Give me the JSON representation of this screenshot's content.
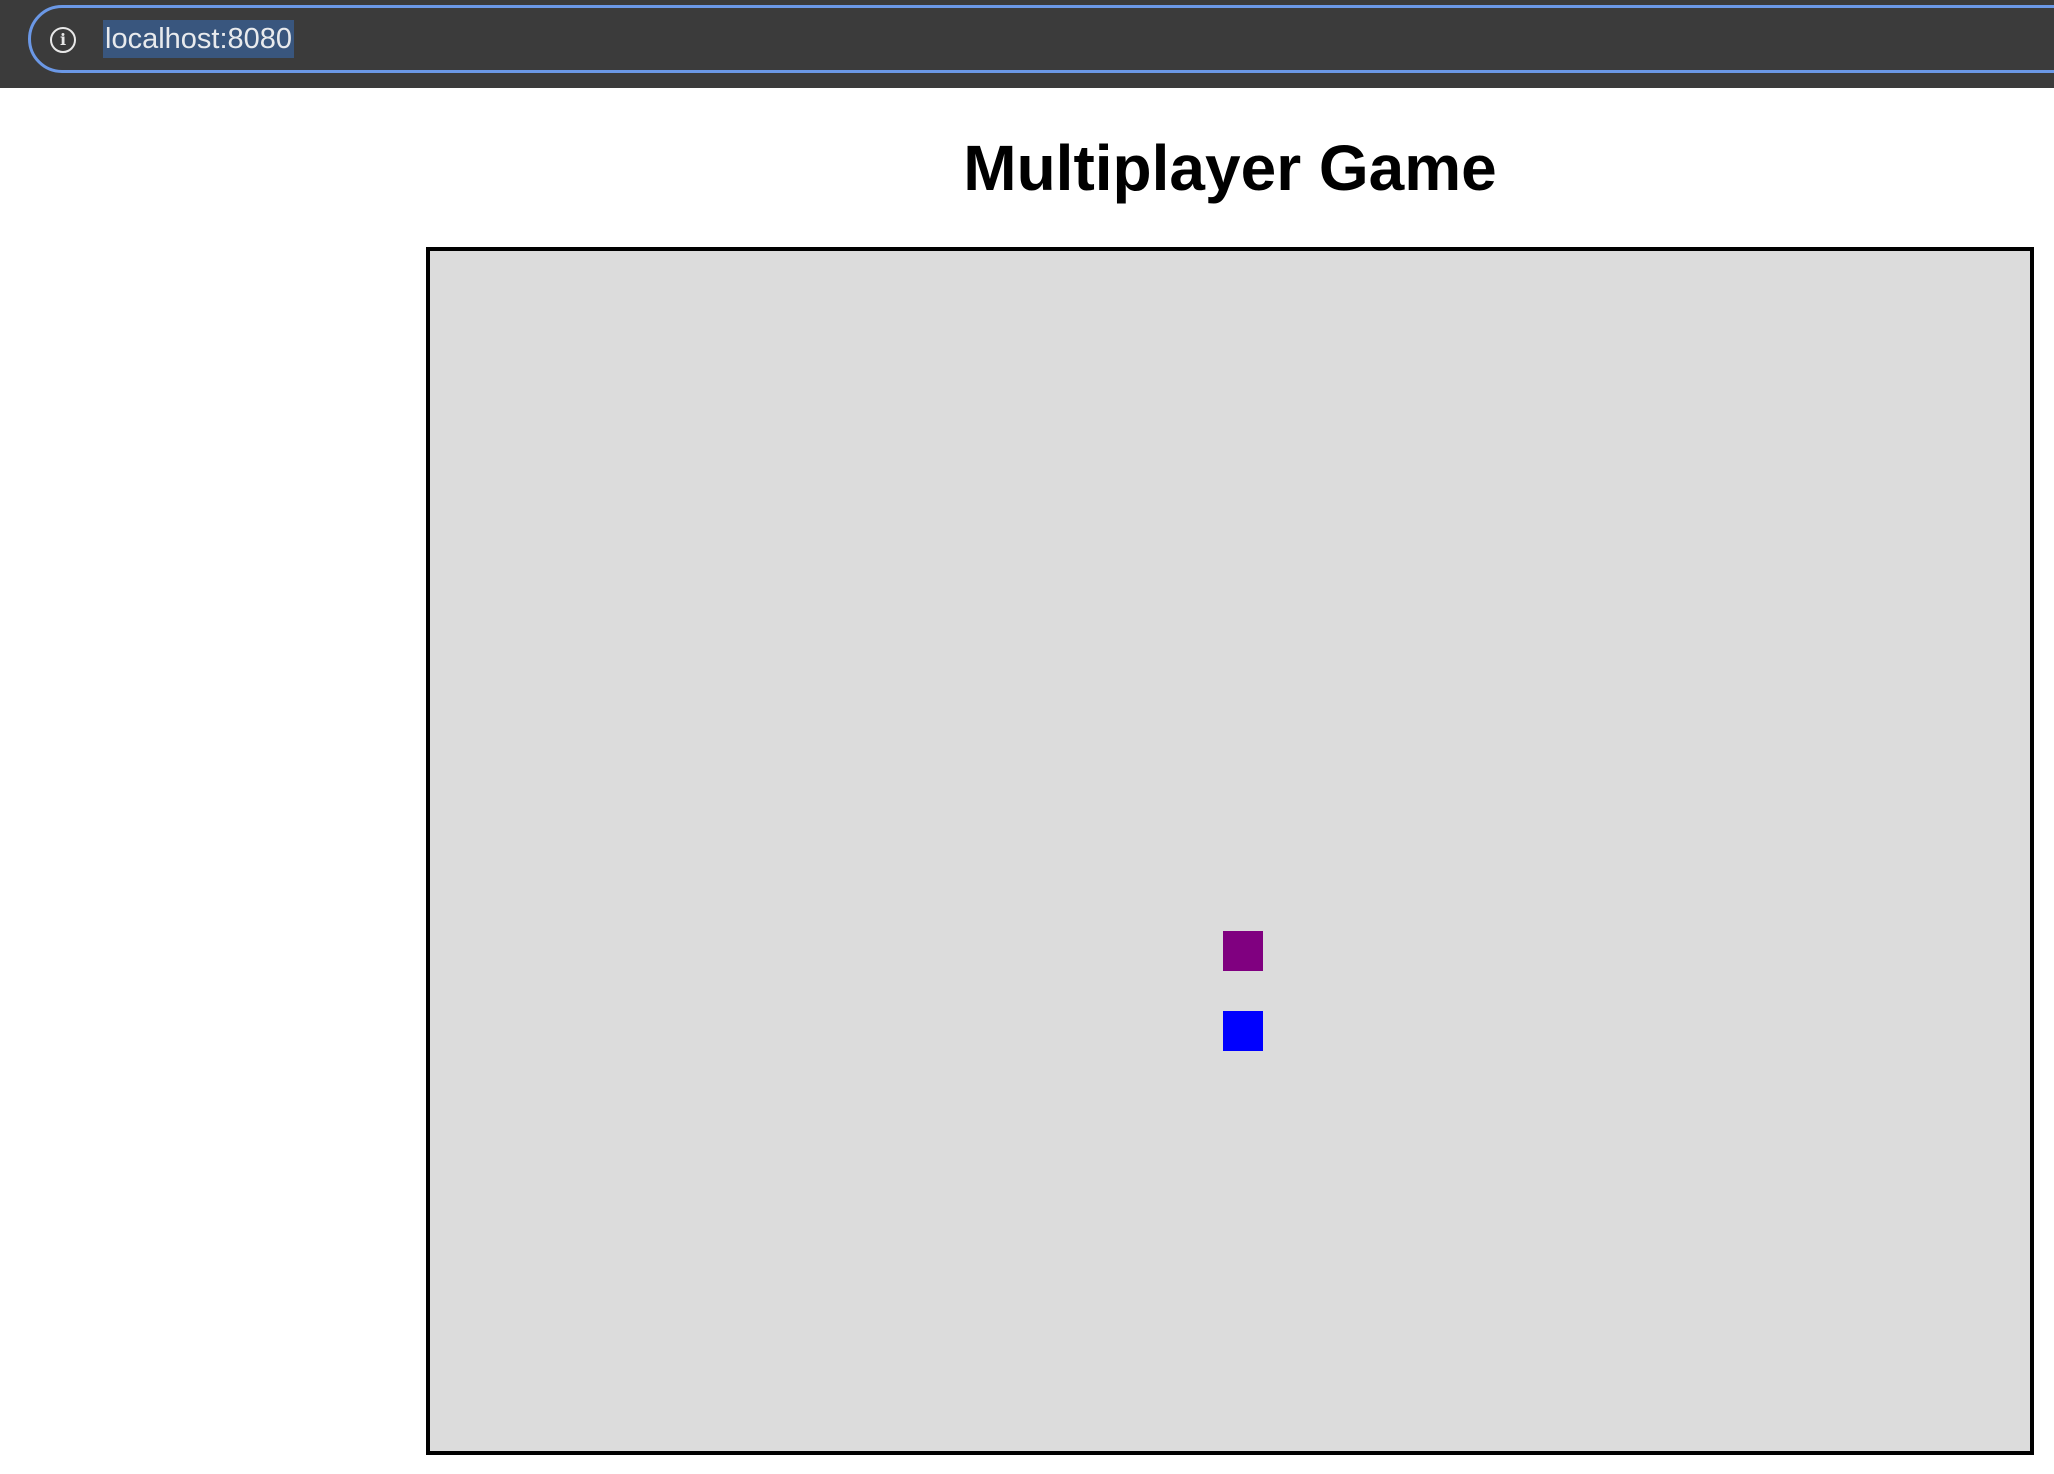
{
  "browser": {
    "url": "localhost:8080",
    "info_icon": "info-circle-icon"
  },
  "page": {
    "title": "Multiplayer Game"
  },
  "game": {
    "background_color": "#dcdcdc",
    "border_color": "#000000",
    "players": [
      {
        "id": "player-1",
        "color": "#800080"
      },
      {
        "id": "player-2",
        "color": "#0000ff"
      }
    ]
  }
}
